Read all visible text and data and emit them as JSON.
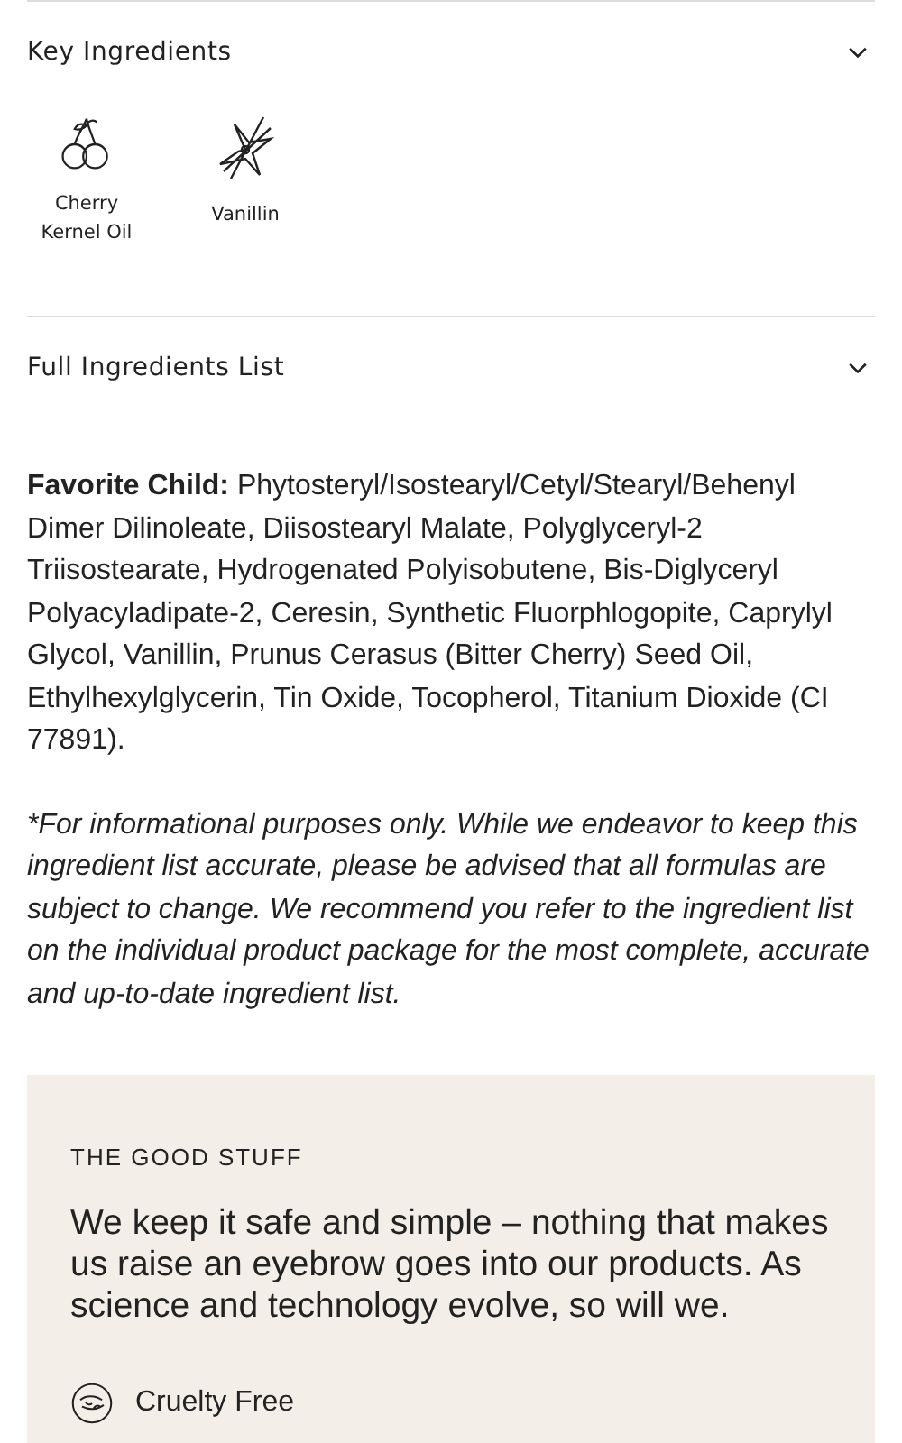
{
  "sections": [
    {
      "title": "Key Ingredients",
      "ingredients": [
        {
          "name": "Cherry Kernel Oil",
          "kind": "cherry"
        },
        {
          "name": "Vanillin",
          "kind": "vanilla"
        }
      ]
    },
    {
      "title": "Full Ingredients List",
      "text": "**Favorite Child:** Phytosteryl/Isostearyl/Cetyl/Stearyl/Behenyl Dimer Dilinoleate, Diisostearyl Malate, Polyglyceryl-2 Triisostearate, Hydrogenated Polyisobutene, Bis-Diglyceryl Polyacyladipate-2, Ceresin, Synthetic Fluorphlogopite, Caprylyl Glycol, Vanillin, Prunus Cerasus (Bitter Cherry) Seed Oil, Ethylhexylglycerin, Tin Oxide, Tocopherol, Titanium Dioxide (CI 77891).",
      "disclaimer": "*For informational purposes only. While we endeavor to keep this ingredient list accurate, please be advised that all formulas are subject to change. We recommend you refer to the ingredient list on the individual product package for the most complete, accurate and up-to-date ingredient list."
    }
  ],
  "good_stuff": {
    "eyebrow": "THE GOOD STUFF",
    "headline": "We keep it safe and simple – nothing that makes us raise an eyebrow goes into our products. As science and technology evolve, so will we.",
    "badges": [
      {
        "label": "Cruelty Free",
        "kind": "cruelty-free"
      }
    ]
  }
}
